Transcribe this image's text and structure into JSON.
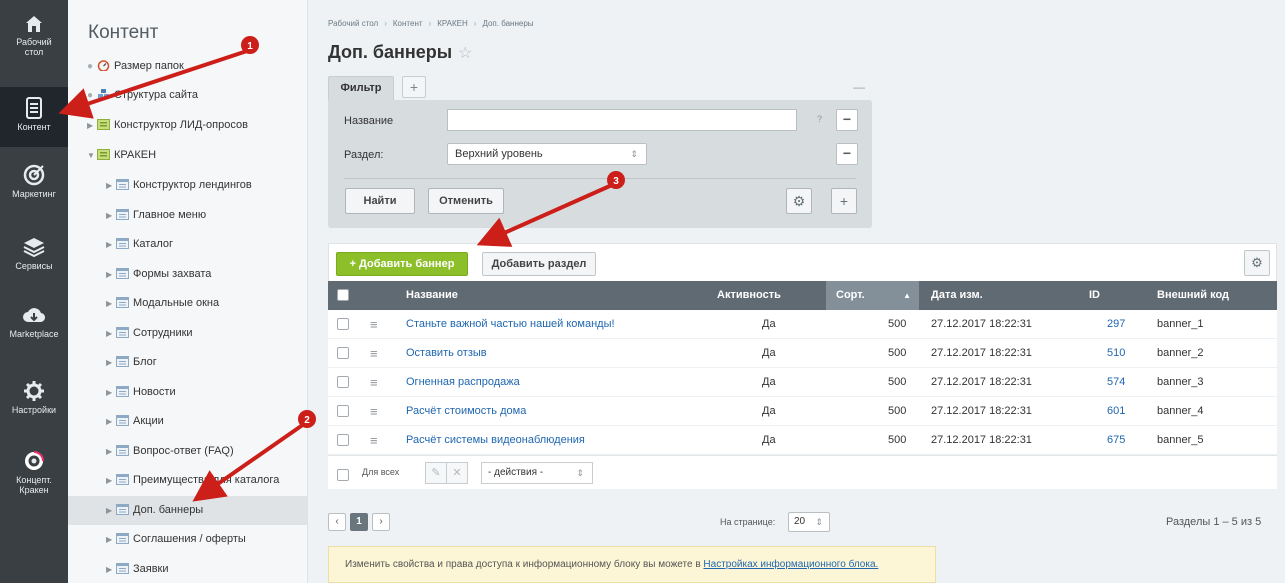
{
  "rail": [
    {
      "label_1": "Рабочий",
      "label_2": "стол",
      "icon": "home-icon"
    },
    {
      "label_1": "Контент",
      "label_2": "",
      "icon": "document-icon",
      "active": true
    },
    {
      "label_1": "Маркетинг",
      "label_2": "",
      "icon": "target-icon"
    },
    {
      "label_1": "Сервисы",
      "label_2": "",
      "icon": "layers-icon"
    },
    {
      "label_1": "Marketplace",
      "label_2": "",
      "icon": "cloud-download-icon"
    },
    {
      "label_1": "Настройки",
      "label_2": "",
      "icon": "gear-icon"
    },
    {
      "label_1": "Концепт.",
      "label_2": "Кракен",
      "icon": "kraken-logo-icon"
    }
  ],
  "tree": {
    "title": "Контент",
    "items": [
      {
        "label": "Размер папок",
        "icon": "gauge-icon"
      },
      {
        "label": "Структура сайта",
        "icon": "sitemap-icon"
      },
      {
        "label": "Конструктор ЛИД-опросов",
        "icon": "folder-icon"
      },
      {
        "label": "КРАКЕН",
        "icon": "folder-icon"
      },
      {
        "label": "Конструктор лендингов",
        "icon": "iblock-icon"
      },
      {
        "label": "Главное меню",
        "icon": "iblock-icon"
      },
      {
        "label": "Каталог",
        "icon": "iblock-icon"
      },
      {
        "label": "Формы захвата",
        "icon": "iblock-icon"
      },
      {
        "label": "Модальные окна",
        "icon": "iblock-icon"
      },
      {
        "label": "Сотрудники",
        "icon": "iblock-icon"
      },
      {
        "label": "Блог",
        "icon": "iblock-icon"
      },
      {
        "label": "Новости",
        "icon": "iblock-icon"
      },
      {
        "label": "Акции",
        "icon": "iblock-icon"
      },
      {
        "label": "Вопрос-ответ (FAQ)",
        "icon": "iblock-icon"
      },
      {
        "label": "Преимущества для каталога",
        "icon": "iblock-icon"
      },
      {
        "label": "Доп. баннеры",
        "icon": "iblock-icon",
        "selected": true
      },
      {
        "label": "Соглашения / оферты",
        "icon": "iblock-icon"
      },
      {
        "label": "Заявки",
        "icon": "iblock-icon"
      }
    ]
  },
  "breadcrumb": [
    "Рабочий стол",
    "Контент",
    "КРАКЕН",
    "Доп. баннеры"
  ],
  "page_title": "Доп. баннеры",
  "filter": {
    "tab_label": "Фильтр",
    "name_label": "Название",
    "name_value": "",
    "help_mark": "?",
    "section_label": "Раздел:",
    "section_value": "Верхний уровень",
    "find_label": "Найти",
    "cancel_label": "Отменить"
  },
  "toolbar": {
    "add_banner_label": "Добавить баннер",
    "add_section_label": "Добавить раздел"
  },
  "table": {
    "columns": [
      "Название",
      "Активность",
      "Сорт.",
      "Дата изм.",
      "ID",
      "Внешний код"
    ],
    "rows": [
      {
        "name": "Станьте важной частью нашей команды!",
        "active": "Да",
        "sort": "500",
        "date": "27.12.2017 18:22:31",
        "id": "297",
        "code": "banner_1"
      },
      {
        "name": "Оставить отзыв",
        "active": "Да",
        "sort": "500",
        "date": "27.12.2017 18:22:31",
        "id": "510",
        "code": "banner_2"
      },
      {
        "name": "Огненная распродажа",
        "active": "Да",
        "sort": "500",
        "date": "27.12.2017 18:22:31",
        "id": "574",
        "code": "banner_3"
      },
      {
        "name": "Расчёт стоимость дома",
        "active": "Да",
        "sort": "500",
        "date": "27.12.2017 18:22:31",
        "id": "601",
        "code": "banner_4"
      },
      {
        "name": "Расчёт системы видеонаблюдения",
        "active": "Да",
        "sort": "500",
        "date": "27.12.2017 18:22:31",
        "id": "675",
        "code": "banner_5"
      }
    ],
    "for_all_label": "Для всех",
    "actions_value": "- действия -"
  },
  "pagination": {
    "current_page": "1",
    "per_page_label": "На странице:",
    "per_page_value": "20",
    "sections_count": "Разделы 1 – 5 из 5"
  },
  "notice": {
    "text": "Изменить свойства и права доступа к информационному блоку вы можете в ",
    "link": "Настройках информационного блока."
  },
  "annotations": [
    "1",
    "2",
    "3"
  ],
  "colors": {
    "accent_green": "#8cbf2a",
    "rail_bg": "#3a3f44",
    "marker_red": "#cc1f1a",
    "link": "#2067b0"
  }
}
